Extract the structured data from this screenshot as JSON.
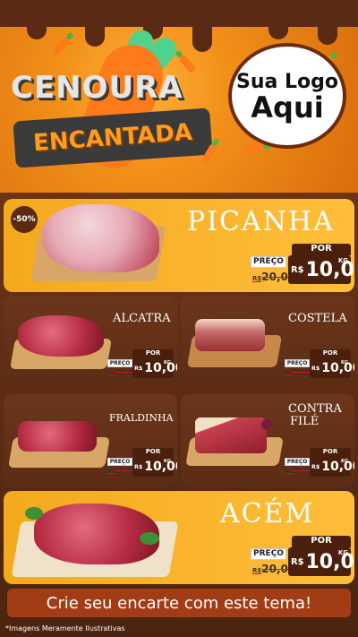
{
  "header": {
    "title_line1": "CENOURA",
    "title_line2": "ENCANTADA",
    "logo_line1": "Sua Logo",
    "logo_line2": "Aqui"
  },
  "products": [
    {
      "name": "PICANHA",
      "discount": "-50%",
      "por": "POR",
      "preco": "PREÇO",
      "old": "20,00",
      "rs": "R$",
      "price": "10,00",
      "kg": "KG"
    },
    {
      "name": "ALCATRA",
      "por": "POR",
      "preco": "PREÇO",
      "old": "20,00",
      "rs": "R$",
      "price": "10,00",
      "kg": "KG"
    },
    {
      "name": "COSTELA",
      "por": "POR",
      "preco": "PREÇO",
      "old": "20,00",
      "rs": "R$",
      "price": "10,00",
      "kg": "KG"
    },
    {
      "name": "FRALDINHA",
      "por": "POR",
      "preco": "PREÇO",
      "old": "20,00",
      "rs": "R$",
      "price": "10,00",
      "kg": "KG"
    },
    {
      "name_line1": "CONTRA",
      "name_line2": "FILÉ",
      "por": "POR",
      "preco": "PREÇO",
      "old": "20,00",
      "rs": "R$",
      "price": "10,00",
      "kg": "KG"
    },
    {
      "name": "ACÉM",
      "por": "POR",
      "preco": "PREÇO",
      "old": "20,00",
      "rs": "R$",
      "price": "10,00",
      "kg": "KG"
    }
  ],
  "banner": "Crie seu encarte com este tema!",
  "disclaimer": "*Imagens Meramente Ilustrativas",
  "colors": {
    "orange": "#f29019",
    "brown": "#5a2a14",
    "yellow": "#ffbe3a"
  }
}
